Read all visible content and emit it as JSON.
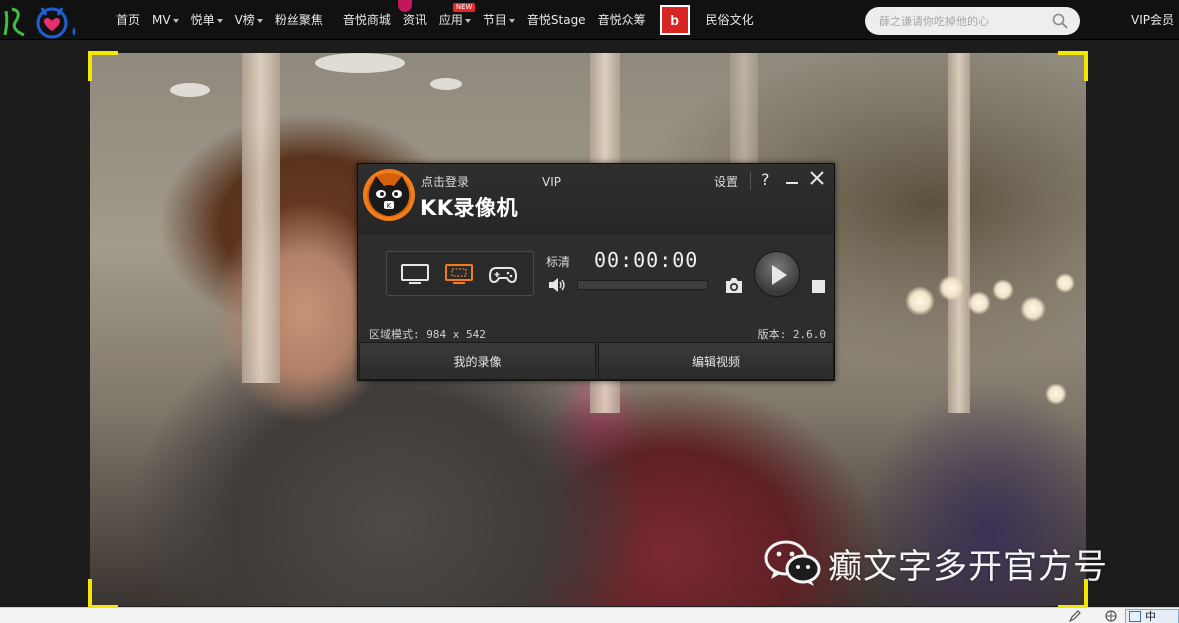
{
  "nav": {
    "items": [
      {
        "label": "首页",
        "caret": false
      },
      {
        "label": "MV",
        "caret": true
      },
      {
        "label": "悦单",
        "caret": true
      },
      {
        "label": "V榜",
        "caret": true
      },
      {
        "label": "粉丝聚焦",
        "caret": false
      },
      {
        "label": "音悦商城",
        "caret": false
      },
      {
        "label": "资讯",
        "caret": false
      },
      {
        "label": "应用",
        "caret": true,
        "badge": "NEW"
      },
      {
        "label": "节目",
        "caret": true
      },
      {
        "label": "音悦Stage",
        "caret": false
      },
      {
        "label": "音悦众筹",
        "caret": false
      }
    ],
    "brand_letter": "b",
    "folk_label": "民俗文化",
    "search_placeholder": "薛之谦请你吃掉他的心",
    "vip_label": "VIP会员",
    "colors": {
      "badge": "#e8262b",
      "brand": "#d92424",
      "logo_green": "#3fbf3f",
      "logo_blue": "#1e5fd2",
      "logo_pink": "#e6306b"
    }
  },
  "watermark": {
    "icon": "wechat-icon",
    "text": "癫文字多开官方号"
  },
  "recorder": {
    "login_label": "点击登录",
    "vip_label": "VIP",
    "title": "KK录像机",
    "settings_label": "设置",
    "help_label": "?",
    "modes": [
      {
        "name": "fullscreen-mode",
        "icon": "monitor-icon",
        "active": false
      },
      {
        "name": "region-mode",
        "icon": "region-monitor-icon",
        "active": true
      },
      {
        "name": "game-mode",
        "icon": "gamepad-icon",
        "active": false
      }
    ],
    "quality_label": "标清",
    "timer": "00:00:00",
    "volume_level": 0,
    "region_info": "区域模式: 984 x 542",
    "version_info": "版本: 2.6.0",
    "my_recordings_label": "我的录像",
    "edit_video_label": "编辑视频",
    "colors": {
      "accent": "#f07d1a",
      "panel": "#2d2d2d"
    }
  },
  "statusbar": {
    "ime_label": "中"
  }
}
